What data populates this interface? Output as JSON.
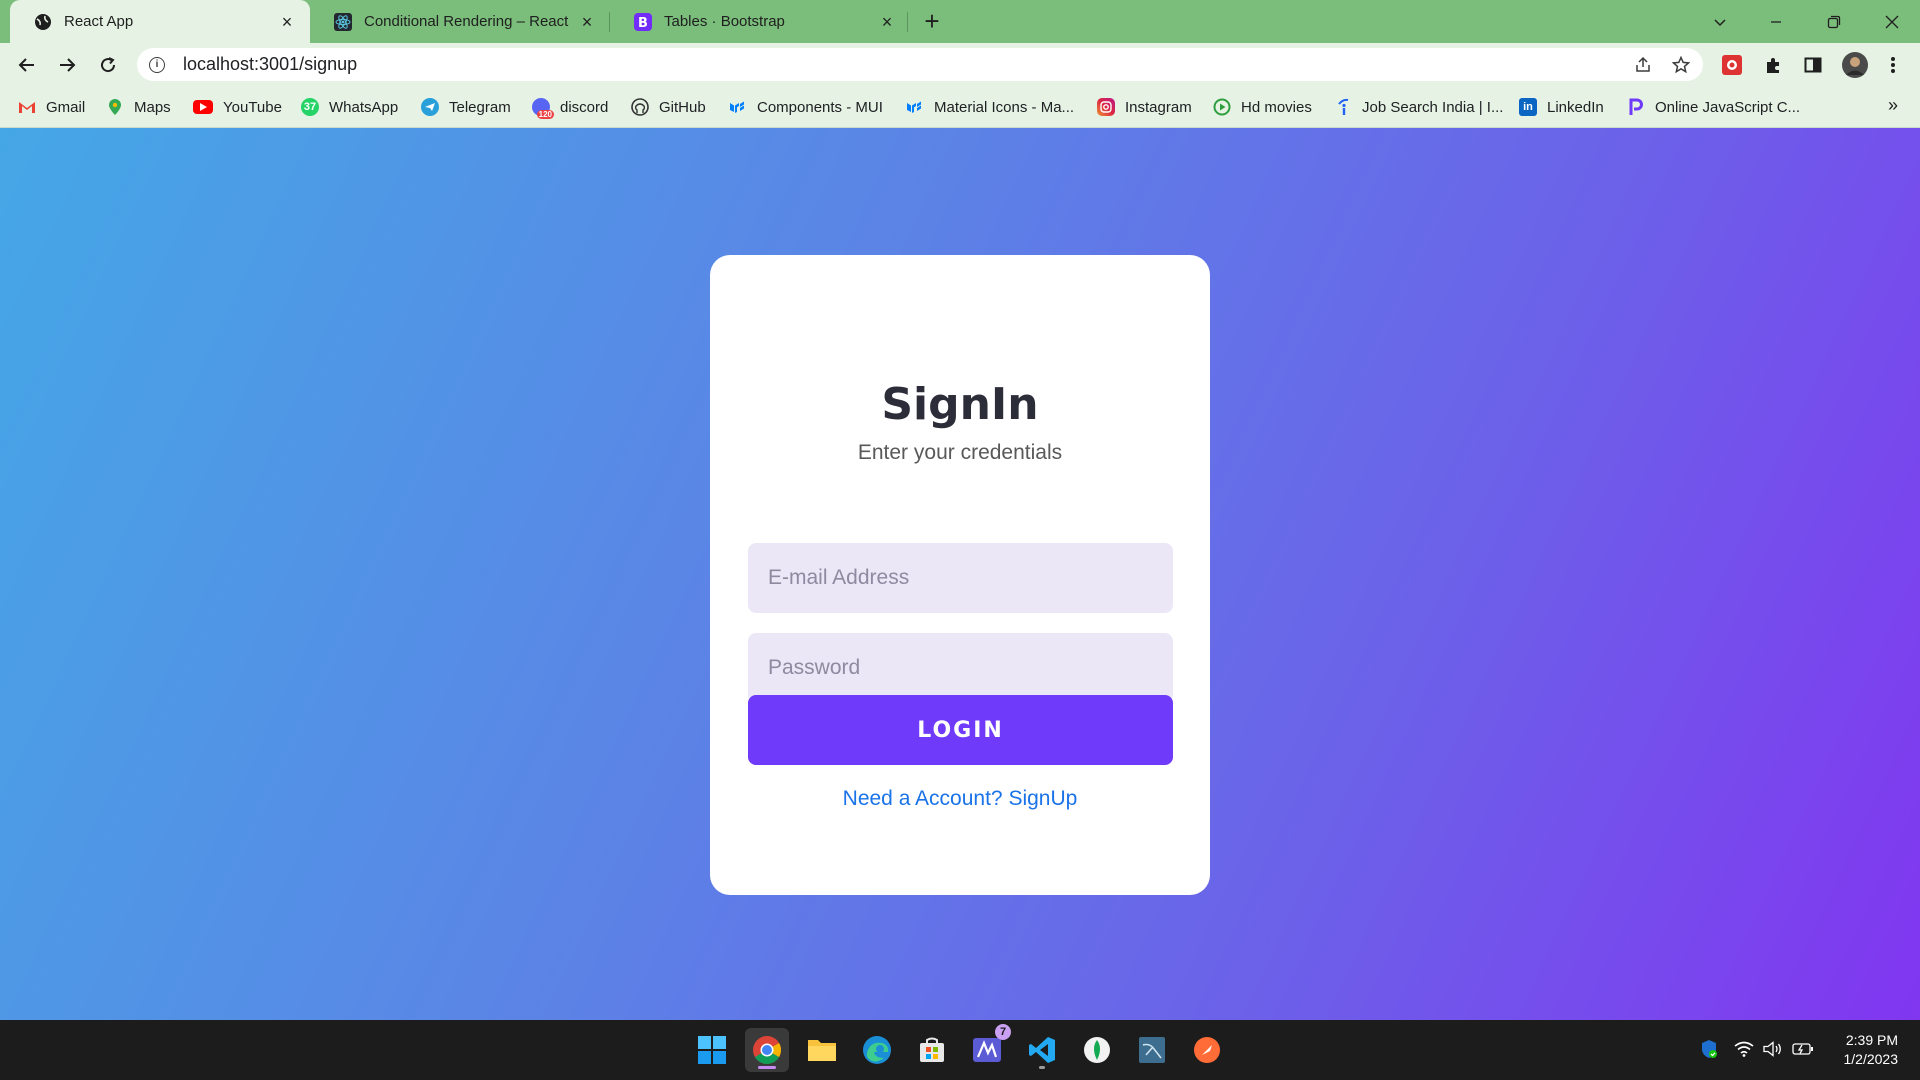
{
  "browser": {
    "tabs": [
      {
        "title": "React App",
        "active": true,
        "icon": "globe-icon"
      },
      {
        "title": "Conditional Rendering – React",
        "active": false,
        "icon": "react-icon"
      },
      {
        "title": "Tables · Bootstrap",
        "active": false,
        "icon": "bootstrap-icon"
      }
    ],
    "url": "localhost:3001/signup",
    "bookmarks": [
      {
        "label": "Gmail",
        "icon": "gmail-icon",
        "color": "#ea4335"
      },
      {
        "label": "Maps",
        "icon": "maps-icon",
        "color": "#34a853"
      },
      {
        "label": "YouTube",
        "icon": "youtube-icon",
        "color": "#ff0000"
      },
      {
        "label": "WhatsApp",
        "icon": "whatsapp-icon",
        "color": "#25d366"
      },
      {
        "label": "Telegram",
        "icon": "telegram-icon",
        "color": "#2aa0da"
      },
      {
        "label": "discord",
        "icon": "discord-icon",
        "color": "#5865f2"
      },
      {
        "label": "GitHub",
        "icon": "github-icon",
        "color": "#333333"
      },
      {
        "label": "Components - MUI",
        "icon": "mui-icon",
        "color": "#007fff"
      },
      {
        "label": "Material Icons - Ma...",
        "icon": "mui-icon",
        "color": "#007fff"
      },
      {
        "label": "Instagram",
        "icon": "instagram-icon",
        "color": "#e1306c"
      },
      {
        "label": "Hd movies",
        "icon": "play-icon",
        "color": "#2e9e3e"
      },
      {
        "label": "Job Search India | I...",
        "icon": "indeed-icon",
        "color": "#2164f3"
      },
      {
        "label": "LinkedIn",
        "icon": "linkedin-icon",
        "color": "#0a66c2"
      },
      {
        "label": "Online JavaScript C...",
        "icon": "programiz-icon",
        "color": "#6f3af9"
      }
    ]
  },
  "signin": {
    "title": "SignIn",
    "subtitle": "Enter your credentials",
    "email_placeholder": "E-mail Address",
    "email_value": "",
    "password_placeholder": "Password",
    "password_value": "",
    "login_label": "LOGIN",
    "signup_link": "Need a Account? SignUp"
  },
  "colors": {
    "accent": "#6f3af9",
    "link": "#1a73e8",
    "input_bg": "#ebe7f7"
  },
  "taskbar": {
    "apps": [
      "windows-start-icon",
      "chrome-icon",
      "file-explorer-icon",
      "edge-icon",
      "microsoft-store-icon",
      "app-icon",
      "vscode-icon",
      "mongodb-compass-icon",
      "mysql-workbench-icon",
      "postman-icon"
    ],
    "notification_badge": "7",
    "time": "2:39 PM",
    "date": "1/2/2023"
  }
}
